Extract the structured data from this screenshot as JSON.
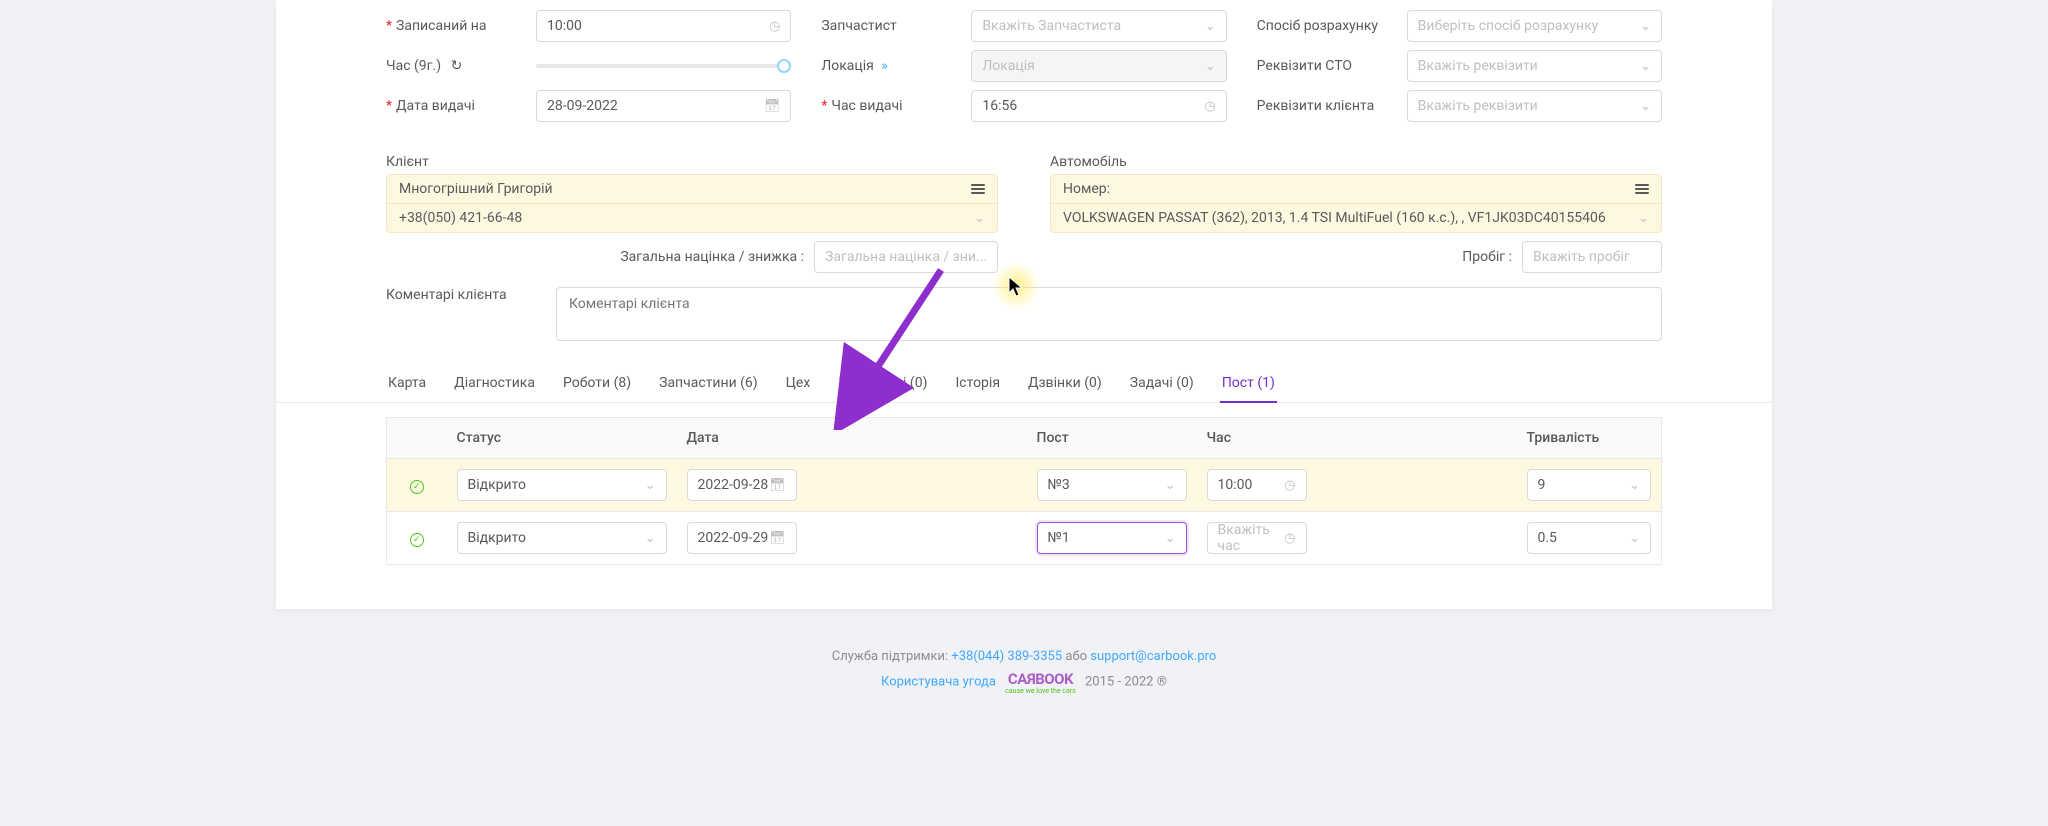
{
  "form": {
    "scheduled_label": "Записаний на",
    "scheduled_value": "10:00",
    "time_label": "Час (9г.)",
    "issue_date_label": "Дата видачі",
    "issue_date_value": "28-09-2022",
    "parts_label": "Запчастист",
    "parts_placeholder": "Вкажіть Запчастиста",
    "location_label": "Локація",
    "location_placeholder": "Локація",
    "issue_time_label": "Час видачі",
    "issue_time_value": "16:56",
    "payment_label": "Спосіб розрахунку",
    "payment_placeholder": "Виберіть спосіб розрахунку",
    "sto_req_label": "Реквізити СТО",
    "client_req_label": "Реквізити клієнта",
    "req_placeholder": "Вкажіть реквізити"
  },
  "client": {
    "section": "Клієнт",
    "name": "Многогрішний Григорій",
    "phone": "+38(050) 421-66-48",
    "markup_label": "Загальна націнка / знижка :",
    "markup_placeholder": "Загальна націнка / зни..."
  },
  "vehicle": {
    "section": "Автомобіль",
    "number_label": "Номер:",
    "desc": "VOLKSWAGEN PASSAT (362), 2013, 1.4 TSI MultiFuel (160 к.с.), , VF1JK03DC40155406",
    "mileage_label": "Пробіг :",
    "mileage_placeholder": "Вкажіть пробіг"
  },
  "comments": {
    "label": "Коментарі клієнта",
    "placeholder": "Коментарі клієнта"
  },
  "tabs": {
    "karta": "Карта",
    "diag": "Діагностика",
    "works": "Роботи (8)",
    "parts": "Запчастини (6)",
    "shop": "Цех",
    "comments": "Коментарі (0)",
    "history": "Історія",
    "calls": "Дзвінки (0)",
    "tasks": "Задачі (0)",
    "post": "Пост (1)"
  },
  "table": {
    "status": "Статус",
    "date": "Дата",
    "post": "Пост",
    "time": "Час",
    "duration": "Тривалість",
    "rows": [
      {
        "status": "Відкрито",
        "date": "2022-09-28",
        "post": "№3",
        "time": "10:00",
        "duration": "9"
      },
      {
        "status": "Відкрито",
        "date": "2022-09-29",
        "post": "№1",
        "time_placeholder": "Вкажіть час",
        "duration": "0.5"
      }
    ]
  },
  "footer": {
    "support_label": "Служба підтримки:",
    "phone": "+38(044) 389-3355",
    "or": " або ",
    "email": "support@carbook.pro",
    "agreement": "Користувача угода",
    "brand": "CAЯBOOK",
    "tagline": "cause we love the cars",
    "years": " 2015 - 2022 "
  }
}
